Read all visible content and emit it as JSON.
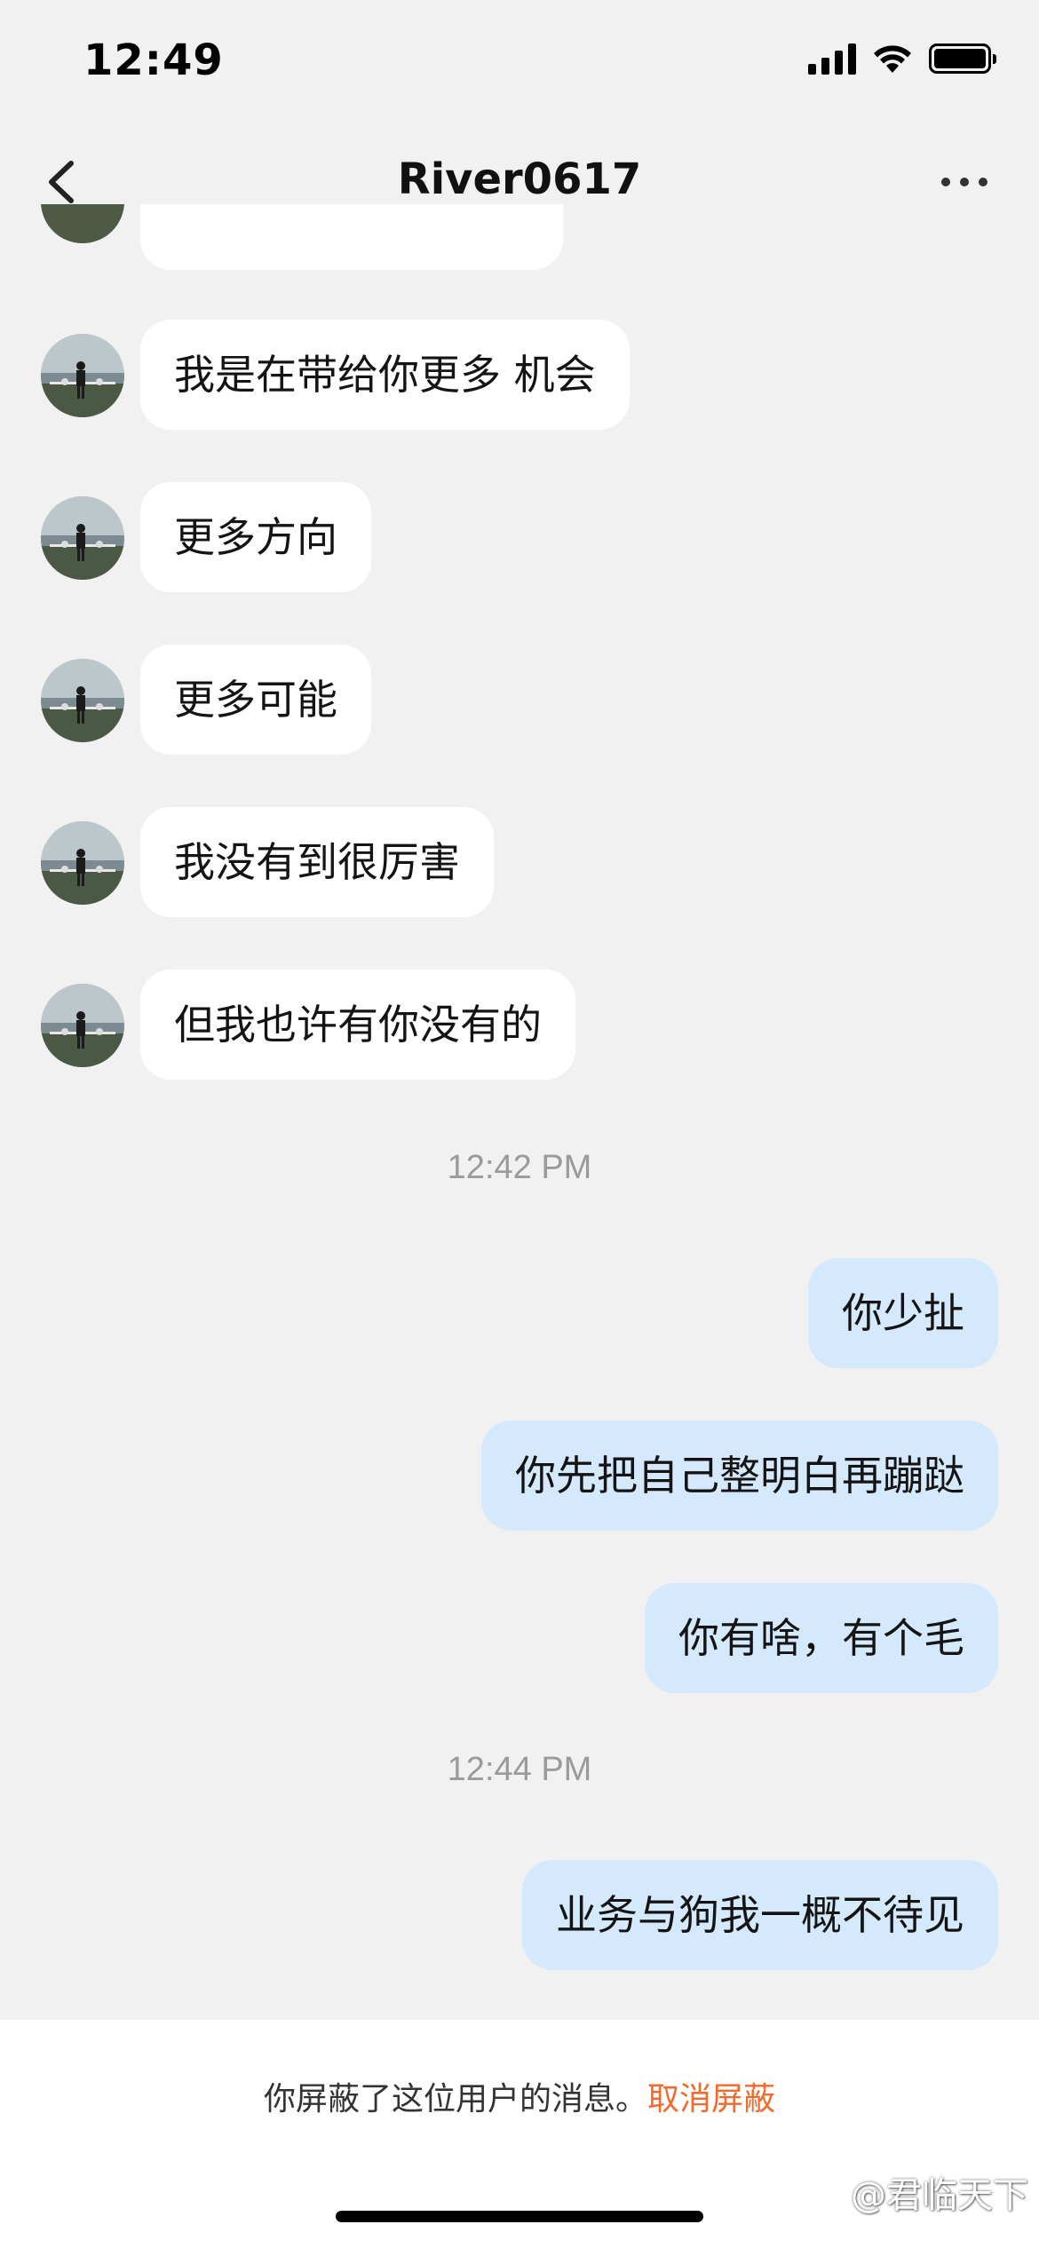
{
  "status_bar": {
    "time": "12:49"
  },
  "nav": {
    "title": "River0617",
    "back_icon": "chevron-left-icon",
    "more_icon": "more-horizontal-icon"
  },
  "messages": [
    {
      "side": "incoming",
      "text": "我是在带给你更多 机会"
    },
    {
      "side": "incoming",
      "text": "更多方向"
    },
    {
      "side": "incoming",
      "text": "更多可能"
    },
    {
      "side": "incoming",
      "text": "我没有到很厉害"
    },
    {
      "side": "incoming",
      "text": "但我也许有你没有的"
    },
    {
      "type": "timestamp",
      "text": "12:42 PM"
    },
    {
      "side": "outgoing",
      "text": "你少扯"
    },
    {
      "side": "outgoing",
      "text": "你先把自己整明白再蹦跶"
    },
    {
      "side": "outgoing",
      "text": "你有啥，有个毛"
    },
    {
      "type": "timestamp",
      "text": "12:44 PM"
    },
    {
      "side": "outgoing",
      "text": "业务与狗我一概不待见"
    }
  ],
  "footer": {
    "blocked_text": "你屏蔽了这位用户的消息。",
    "unblock_label": "取消屏蔽"
  },
  "watermark": "@君临天下",
  "colors": {
    "background": "#f1f1f1",
    "incoming_bubble": "#ffffff",
    "outgoing_bubble": "#d4e9fc",
    "link": "#f26a2e",
    "timestamp": "#9a9a9a"
  }
}
